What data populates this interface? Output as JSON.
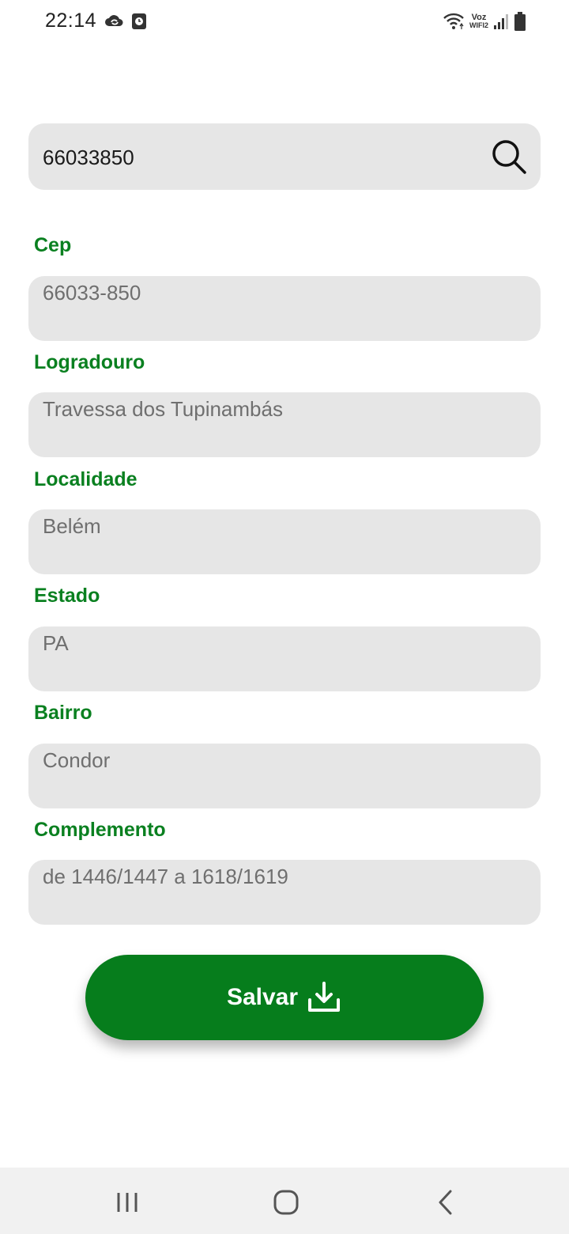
{
  "status_bar": {
    "time": "22:14",
    "network_line1": "Voz",
    "network_line2": "WIFI2",
    "icons": [
      "cloud-sync-icon",
      "screen-recorder-icon",
      "wifi-icon",
      "signal-icon",
      "battery-icon"
    ]
  },
  "search": {
    "value": "66033850",
    "icon": "search-icon"
  },
  "fields": {
    "cep": {
      "label": "Cep",
      "value": "66033-850"
    },
    "logradouro": {
      "label": "Logradouro",
      "value": "Travessa dos Tupinambás"
    },
    "localidade": {
      "label": "Localidade",
      "value": "Belém"
    },
    "estado": {
      "label": "Estado",
      "value": "PA"
    },
    "bairro": {
      "label": "Bairro",
      "value": "Condor"
    },
    "complemento": {
      "label": "Complemento",
      "value": "de 1446/1447 a 1618/1619"
    }
  },
  "save_button": {
    "label": "Salvar",
    "icon": "download-icon"
  },
  "nav_bar": {
    "icons": [
      "recent-apps-icon",
      "home-icon",
      "back-icon"
    ]
  },
  "colors": {
    "accent_green": "#067d1c",
    "label_green": "#0a8020",
    "field_bg": "#e6e6e6",
    "value_gray": "#6f6f6f",
    "nav_bg": "#f1f1f1"
  }
}
